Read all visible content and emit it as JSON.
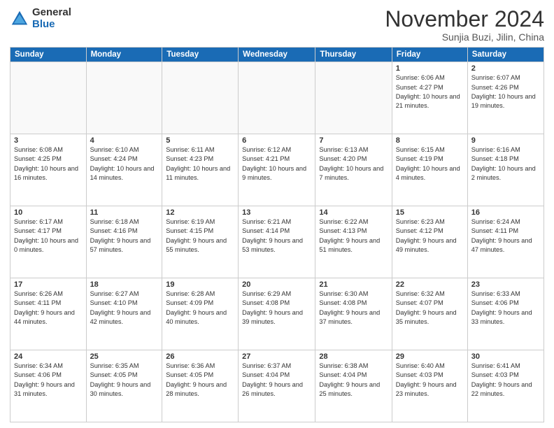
{
  "logo": {
    "general": "General",
    "blue": "Blue"
  },
  "title": "November 2024",
  "location": "Sunjia Buzi, Jilin, China",
  "weekdays": [
    "Sunday",
    "Monday",
    "Tuesday",
    "Wednesday",
    "Thursday",
    "Friday",
    "Saturday"
  ],
  "weeks": [
    [
      {
        "day": "",
        "info": ""
      },
      {
        "day": "",
        "info": ""
      },
      {
        "day": "",
        "info": ""
      },
      {
        "day": "",
        "info": ""
      },
      {
        "day": "",
        "info": ""
      },
      {
        "day": "1",
        "info": "Sunrise: 6:06 AM\nSunset: 4:27 PM\nDaylight: 10 hours and 21 minutes."
      },
      {
        "day": "2",
        "info": "Sunrise: 6:07 AM\nSunset: 4:26 PM\nDaylight: 10 hours and 19 minutes."
      }
    ],
    [
      {
        "day": "3",
        "info": "Sunrise: 6:08 AM\nSunset: 4:25 PM\nDaylight: 10 hours and 16 minutes."
      },
      {
        "day": "4",
        "info": "Sunrise: 6:10 AM\nSunset: 4:24 PM\nDaylight: 10 hours and 14 minutes."
      },
      {
        "day": "5",
        "info": "Sunrise: 6:11 AM\nSunset: 4:23 PM\nDaylight: 10 hours and 11 minutes."
      },
      {
        "day": "6",
        "info": "Sunrise: 6:12 AM\nSunset: 4:21 PM\nDaylight: 10 hours and 9 minutes."
      },
      {
        "day": "7",
        "info": "Sunrise: 6:13 AM\nSunset: 4:20 PM\nDaylight: 10 hours and 7 minutes."
      },
      {
        "day": "8",
        "info": "Sunrise: 6:15 AM\nSunset: 4:19 PM\nDaylight: 10 hours and 4 minutes."
      },
      {
        "day": "9",
        "info": "Sunrise: 6:16 AM\nSunset: 4:18 PM\nDaylight: 10 hours and 2 minutes."
      }
    ],
    [
      {
        "day": "10",
        "info": "Sunrise: 6:17 AM\nSunset: 4:17 PM\nDaylight: 10 hours and 0 minutes."
      },
      {
        "day": "11",
        "info": "Sunrise: 6:18 AM\nSunset: 4:16 PM\nDaylight: 9 hours and 57 minutes."
      },
      {
        "day": "12",
        "info": "Sunrise: 6:19 AM\nSunset: 4:15 PM\nDaylight: 9 hours and 55 minutes."
      },
      {
        "day": "13",
        "info": "Sunrise: 6:21 AM\nSunset: 4:14 PM\nDaylight: 9 hours and 53 minutes."
      },
      {
        "day": "14",
        "info": "Sunrise: 6:22 AM\nSunset: 4:13 PM\nDaylight: 9 hours and 51 minutes."
      },
      {
        "day": "15",
        "info": "Sunrise: 6:23 AM\nSunset: 4:12 PM\nDaylight: 9 hours and 49 minutes."
      },
      {
        "day": "16",
        "info": "Sunrise: 6:24 AM\nSunset: 4:11 PM\nDaylight: 9 hours and 47 minutes."
      }
    ],
    [
      {
        "day": "17",
        "info": "Sunrise: 6:26 AM\nSunset: 4:11 PM\nDaylight: 9 hours and 44 minutes."
      },
      {
        "day": "18",
        "info": "Sunrise: 6:27 AM\nSunset: 4:10 PM\nDaylight: 9 hours and 42 minutes."
      },
      {
        "day": "19",
        "info": "Sunrise: 6:28 AM\nSunset: 4:09 PM\nDaylight: 9 hours and 40 minutes."
      },
      {
        "day": "20",
        "info": "Sunrise: 6:29 AM\nSunset: 4:08 PM\nDaylight: 9 hours and 39 minutes."
      },
      {
        "day": "21",
        "info": "Sunrise: 6:30 AM\nSunset: 4:08 PM\nDaylight: 9 hours and 37 minutes."
      },
      {
        "day": "22",
        "info": "Sunrise: 6:32 AM\nSunset: 4:07 PM\nDaylight: 9 hours and 35 minutes."
      },
      {
        "day": "23",
        "info": "Sunrise: 6:33 AM\nSunset: 4:06 PM\nDaylight: 9 hours and 33 minutes."
      }
    ],
    [
      {
        "day": "24",
        "info": "Sunrise: 6:34 AM\nSunset: 4:06 PM\nDaylight: 9 hours and 31 minutes."
      },
      {
        "day": "25",
        "info": "Sunrise: 6:35 AM\nSunset: 4:05 PM\nDaylight: 9 hours and 30 minutes."
      },
      {
        "day": "26",
        "info": "Sunrise: 6:36 AM\nSunset: 4:05 PM\nDaylight: 9 hours and 28 minutes."
      },
      {
        "day": "27",
        "info": "Sunrise: 6:37 AM\nSunset: 4:04 PM\nDaylight: 9 hours and 26 minutes."
      },
      {
        "day": "28",
        "info": "Sunrise: 6:38 AM\nSunset: 4:04 PM\nDaylight: 9 hours and 25 minutes."
      },
      {
        "day": "29",
        "info": "Sunrise: 6:40 AM\nSunset: 4:03 PM\nDaylight: 9 hours and 23 minutes."
      },
      {
        "day": "30",
        "info": "Sunrise: 6:41 AM\nSunset: 4:03 PM\nDaylight: 9 hours and 22 minutes."
      }
    ]
  ]
}
